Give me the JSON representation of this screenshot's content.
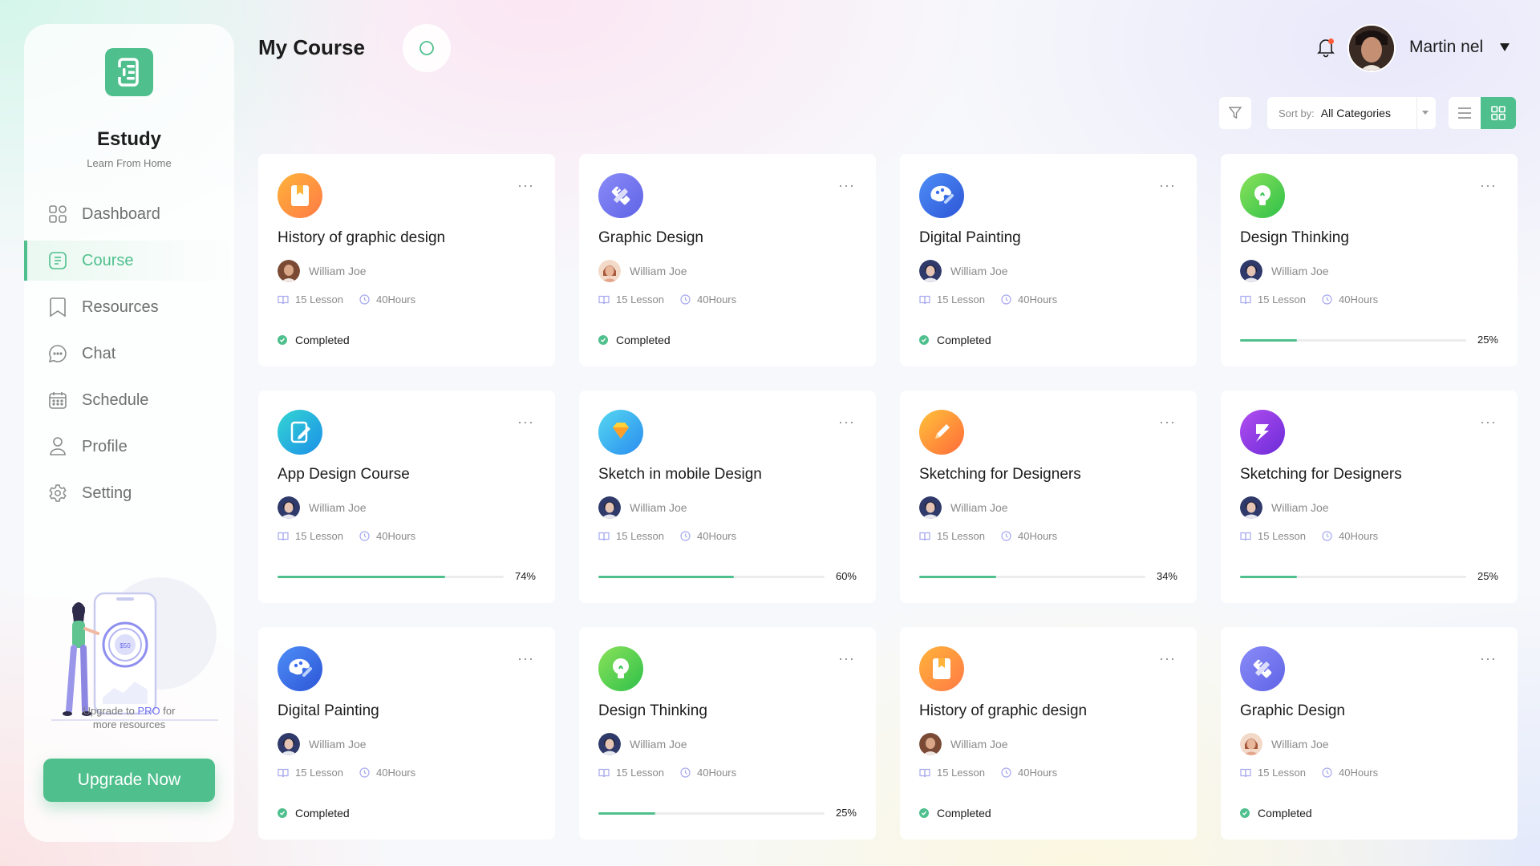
{
  "app": {
    "brand": "Estudy",
    "tagline": "Learn From Home",
    "accent_color": "#4fc08d"
  },
  "sidebar": {
    "items": [
      {
        "label": "Dashboard",
        "icon": "dashboard-icon",
        "active": false
      },
      {
        "label": "Course",
        "icon": "course-icon",
        "active": true
      },
      {
        "label": "Resources",
        "icon": "bookmark-icon",
        "active": false
      },
      {
        "label": "Chat",
        "icon": "chat-icon",
        "active": false
      },
      {
        "label": "Schedule",
        "icon": "calendar-icon",
        "active": false
      },
      {
        "label": "Profile",
        "icon": "user-icon",
        "active": false
      },
      {
        "label": "Setting",
        "icon": "gear-icon",
        "active": false
      }
    ],
    "promo_amount": "$50",
    "upgrade_text_prefix": "Upgrade  to ",
    "upgrade_text_pro": "PRO",
    "upgrade_text_suffix": " for",
    "upgrade_text_line2": "more resources",
    "upgrade_button": "Upgrade Now"
  },
  "header": {
    "title": "My Course",
    "user_name": "Martin nel"
  },
  "toolbar": {
    "sort_label": "Sort by:",
    "sort_value": "All Categories"
  },
  "courses": [
    {
      "title": "History of graphic design",
      "instructor": "William Joe",
      "lessons": "15 Lesson",
      "hours": "40Hours",
      "status": "Completed",
      "progress": null,
      "progress_label": "",
      "icon": "bookmark-book-icon",
      "icon_colors": [
        "#ffb33a",
        "#ff7a45"
      ],
      "avatar": "female"
    },
    {
      "title": "Graphic Design",
      "instructor": "William Joe",
      "lessons": "15 Lesson",
      "hours": "40Hours",
      "status": "Completed",
      "progress": null,
      "progress_label": "",
      "icon": "ruler-pencil-icon",
      "icon_colors": [
        "#8a8cf7",
        "#5f63e6"
      ],
      "avatar": "female2"
    },
    {
      "title": "Digital Painting",
      "instructor": "William Joe",
      "lessons": "15 Lesson",
      "hours": "40Hours",
      "status": "Completed",
      "progress": null,
      "progress_label": "",
      "icon": "palette-icon",
      "icon_colors": [
        "#4e8ef7",
        "#2d55d6"
      ],
      "avatar": "male"
    },
    {
      "title": "Design Thinking",
      "instructor": "William Joe",
      "lessons": "15 Lesson",
      "hours": "40Hours",
      "status": "",
      "progress": 0.25,
      "progress_label": "25%",
      "icon": "lightbulb-icon",
      "icon_colors": [
        "#8ae25a",
        "#2fc04a"
      ],
      "avatar": "male"
    },
    {
      "title": "App Design Course",
      "instructor": "William Joe",
      "lessons": "15 Lesson",
      "hours": "40Hours",
      "status": "",
      "progress": 0.74,
      "progress_label": "74%",
      "icon": "tablet-edit-icon",
      "icon_colors": [
        "#34d6d2",
        "#1b8fe8"
      ],
      "avatar": "male"
    },
    {
      "title": "Sketch in mobile Design",
      "instructor": "William Joe",
      "lessons": "15 Lesson",
      "hours": "40Hours",
      "status": "",
      "progress": 0.6,
      "progress_label": "60%",
      "icon": "diamond-icon",
      "icon_colors": [
        "#55d8f0",
        "#2a8cf0"
      ],
      "avatar": "male"
    },
    {
      "title": "Sketching for Designers",
      "instructor": "William Joe",
      "lessons": "15 Lesson",
      "hours": "40Hours",
      "status": "",
      "progress": 0.34,
      "progress_label": "34%",
      "icon": "pencil-icon",
      "icon_colors": [
        "#ffc23a",
        "#ff6a3a"
      ],
      "avatar": "male"
    },
    {
      "title": "Sketching for Designers",
      "instructor": "William Joe",
      "lessons": "15 Lesson",
      "hours": "40Hours",
      "status": "",
      "progress": 0.25,
      "progress_label": "25%",
      "icon": "zeplin-icon",
      "icon_colors": [
        "#b24ef0",
        "#6b2bd8"
      ],
      "avatar": "male"
    },
    {
      "title": "Digital Painting",
      "instructor": "William Joe",
      "lessons": "15 Lesson",
      "hours": "40Hours",
      "status": "Completed",
      "progress": null,
      "progress_label": "",
      "icon": "palette-icon",
      "icon_colors": [
        "#4e8ef7",
        "#2d55d6"
      ],
      "avatar": "male"
    },
    {
      "title": "Design Thinking",
      "instructor": "William Joe",
      "lessons": "15 Lesson",
      "hours": "40Hours",
      "status": "",
      "progress": 0.25,
      "progress_label": "25%",
      "icon": "lightbulb-icon",
      "icon_colors": [
        "#8ae25a",
        "#2fc04a"
      ],
      "avatar": "male"
    },
    {
      "title": "History of graphic design",
      "instructor": "William Joe",
      "lessons": "15 Lesson",
      "hours": "40Hours",
      "status": "Completed",
      "progress": null,
      "progress_label": "",
      "icon": "bookmark-book-icon",
      "icon_colors": [
        "#ffb33a",
        "#ff7a45"
      ],
      "avatar": "female"
    },
    {
      "title": "Graphic Design",
      "instructor": "William Joe",
      "lessons": "15 Lesson",
      "hours": "40Hours",
      "status": "Completed",
      "progress": null,
      "progress_label": "",
      "icon": "ruler-pencil-icon",
      "icon_colors": [
        "#8a8cf7",
        "#5f63e6"
      ],
      "avatar": "female2"
    }
  ]
}
